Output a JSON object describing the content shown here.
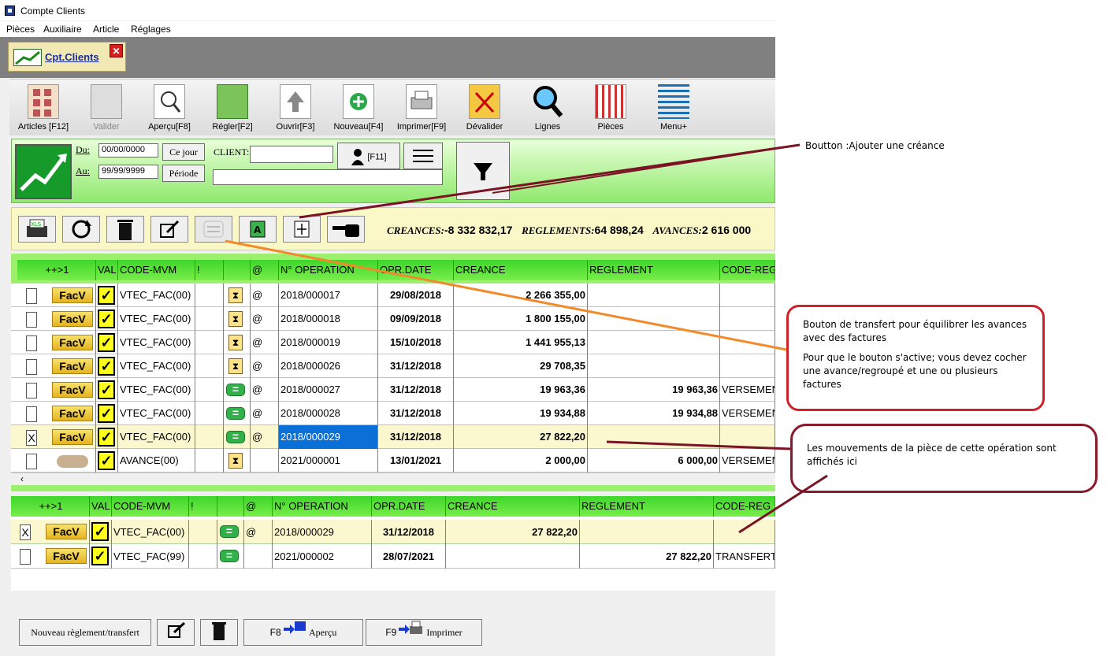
{
  "window": {
    "title": "Compte Clients"
  },
  "menu": [
    "Pièces",
    "Auxiliaire",
    "Article",
    "Réglages"
  ],
  "tab": {
    "label": "Cpt.Clients",
    "close": "✕"
  },
  "toolbar": [
    {
      "label": "Articles [F12]"
    },
    {
      "label": "Valider"
    },
    {
      "label": "Aperçu[F8]"
    },
    {
      "label": "Régler[F2]"
    },
    {
      "label": "Ouvrir[F3]"
    },
    {
      "label": "Nouveau[F4]"
    },
    {
      "label": "Imprimer[F9]"
    },
    {
      "label": "Dévalider"
    },
    {
      "label": "Lignes"
    },
    {
      "label": "Pièces"
    },
    {
      "label": "Menu+"
    }
  ],
  "filter": {
    "du_label": "Du:",
    "du_value": "00/00/0000",
    "au_label": "Au:",
    "au_value": "99/99/9999",
    "ce_jour": "Ce jour",
    "periode": "Période",
    "client_label": "CLIENT:",
    "client_value": "",
    "client_name": "",
    "f11": "[F11]"
  },
  "totals": {
    "creances_label": "CREANCES:",
    "creances_value": "-8 332 832,17",
    "reglements_label": "REGLEMENTS:",
    "reglements_value": "64 898,24",
    "avances_label": "AVANCES:",
    "avances_value": "2 616 000"
  },
  "grid1": {
    "columns": [
      "++>1",
      "VAL",
      "CODE-MVM",
      "!",
      "",
      "@",
      "N° OPERATION",
      "OPR.DATE",
      "CREANCE",
      "REGLEMENT",
      "CODE-REG"
    ],
    "rows": [
      {
        "cb": "",
        "type": "FacV",
        "code": "VTEC_FAC(00)",
        "st": "hour",
        "at": "@",
        "op": "2018/000017",
        "date": "29/08/2018",
        "creance": "2 266 355,00",
        "reg": "",
        "coder": ""
      },
      {
        "cb": "",
        "type": "FacV",
        "code": "VTEC_FAC(00)",
        "st": "hour",
        "at": "@",
        "op": "2018/000018",
        "date": "09/09/2018",
        "creance": "1 800 155,00",
        "reg": "",
        "coder": ""
      },
      {
        "cb": "",
        "type": "FacV",
        "code": "VTEC_FAC(00)",
        "st": "hour",
        "at": "@",
        "op": "2018/000019",
        "date": "15/10/2018",
        "creance": "1 441 955,13",
        "reg": "",
        "coder": ""
      },
      {
        "cb": "",
        "type": "FacV",
        "code": "VTEC_FAC(00)",
        "st": "hour",
        "at": "@",
        "op": "2018/000026",
        "date": "31/12/2018",
        "creance": "29 708,35",
        "reg": "",
        "coder": ""
      },
      {
        "cb": "",
        "type": "FacV",
        "code": "VTEC_FAC(00)",
        "st": "eq",
        "at": "@",
        "op": "2018/000027",
        "date": "31/12/2018",
        "creance": "19 963,36",
        "reg": "19 963,36",
        "coder": "VERSEMEN"
      },
      {
        "cb": "",
        "type": "FacV",
        "code": "VTEC_FAC(00)",
        "st": "eq",
        "at": "@",
        "op": "2018/000028",
        "date": "31/12/2018",
        "creance": "19 934,88",
        "reg": "19 934,88",
        "coder": "VERSEMEN"
      },
      {
        "cb": "X",
        "type": "FacV",
        "code": "VTEC_FAC(00)",
        "st": "eq",
        "at": "@",
        "op": "2018/000029",
        "date": "31/12/2018",
        "creance": "27 822,20",
        "reg": "",
        "coder": ""
      },
      {
        "cb": "",
        "type": "",
        "code": "AVANCE(00)",
        "st": "hour",
        "at": "",
        "op": "2021/000001",
        "date": "13/01/2021",
        "creance": "2 000,00",
        "reg": "6 000,00",
        "coder": "VERSEMEN"
      }
    ]
  },
  "grid2": {
    "columns": [
      "++>1",
      "VAL",
      "CODE-MVM",
      "!",
      "",
      "@",
      "N° OPERATION",
      "OPR.DATE",
      "CREANCE",
      "REGLEMENT",
      "CODE-REG"
    ],
    "rows": [
      {
        "cb": "X",
        "type": "FacV",
        "code": "VTEC_FAC(00)",
        "at": "@",
        "op": "2018/000029",
        "date": "31/12/2018",
        "creance": "27 822,20",
        "reg": "",
        "coder": ""
      },
      {
        "cb": "",
        "type": "FacV",
        "code": "VTEC_FAC(99)",
        "at": "",
        "op": "2021/000002",
        "date": "28/07/2021",
        "creance": "",
        "reg": "27 822,20",
        "coder": "TRANSFERT"
      }
    ]
  },
  "bottom": {
    "nouveau": "Nouveau règlement/transfert",
    "f8": "F8",
    "apercu": "Aperçu",
    "f9": "F9",
    "imprimer": "Imprimer"
  },
  "annotations": {
    "a1": "Boutton :Ajouter une créance",
    "a2_p1": "Bouton de transfert pour équilibrer les avances avec des factures",
    "a2_p2": "Pour que le bouton s'active; vous devez cocher une avance/regroupé et une ou plusieurs factures",
    "a3": "Les mouvements de la pièce de cette opération sont affichés ici"
  },
  "colors": {
    "green_header": "#3ed62a",
    "panel_green": "#9cf06d",
    "facv_yellow": "#f8e26b",
    "callout_red": "#d0202a",
    "callout_dark": "#8a1a2a",
    "arrow_orange": "#f08a2a"
  }
}
